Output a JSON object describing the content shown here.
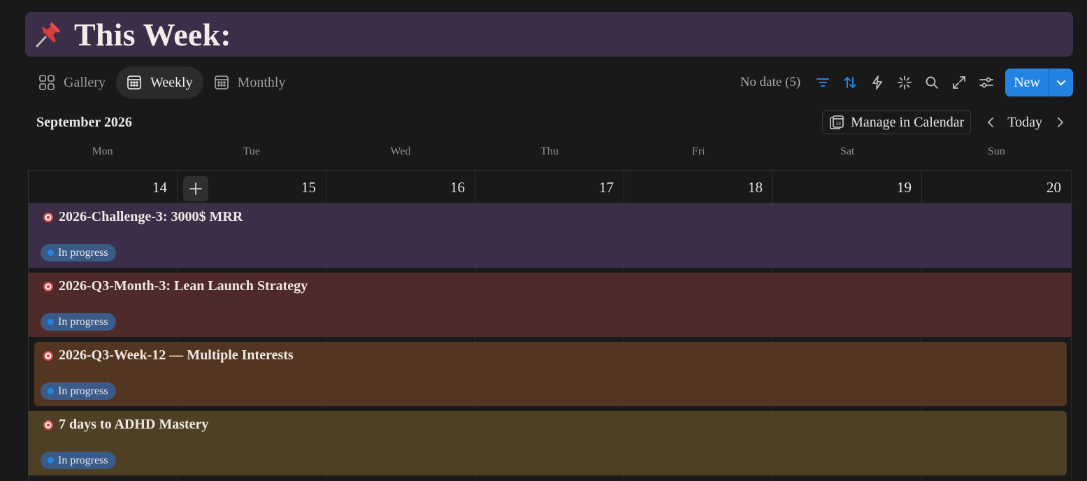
{
  "page": {
    "title": "This Week:",
    "title_icon": "pushpin-icon"
  },
  "views": [
    {
      "label": "Gallery",
      "icon": "gallery-grid-icon",
      "active": false
    },
    {
      "label": "Weekly",
      "icon": "calendar-icon",
      "active": true
    },
    {
      "label": "Monthly",
      "icon": "calendar-icon",
      "active": false
    }
  ],
  "toolbar": {
    "no_date": "No date (5)",
    "icons": [
      "filter-icon",
      "sort-icon",
      "automation-bolt-icon",
      "ai-sparkle-icon",
      "search-icon",
      "expand-icon",
      "settings-sliders-icon"
    ],
    "new_label": "New",
    "accent": "#2383e2"
  },
  "calendar": {
    "month_label": "September 2026",
    "manage_label": "Manage in Calendar",
    "today_label": "Today",
    "weekdays": [
      "Mon",
      "Tue",
      "Wed",
      "Thu",
      "Fri",
      "Sat",
      "Sun"
    ],
    "days": [
      "14",
      "15",
      "16",
      "17",
      "18",
      "19",
      "20"
    ]
  },
  "events": [
    {
      "title": "2026-Challenge-3: 3000$ MRR",
      "status": "In progress",
      "color": "#3c2d49"
    },
    {
      "title": "2026-Q3-Month-3: Lean Launch Strategy",
      "status": "In progress",
      "color": "#4e2a28"
    },
    {
      "title": "2026-Q3-Week-12 — Multiple Interests",
      "status": "In progress",
      "color": "#533622"
    },
    {
      "title": "7 days to ADHD Mastery",
      "status": "In progress",
      "color": "#4d4024"
    }
  ]
}
